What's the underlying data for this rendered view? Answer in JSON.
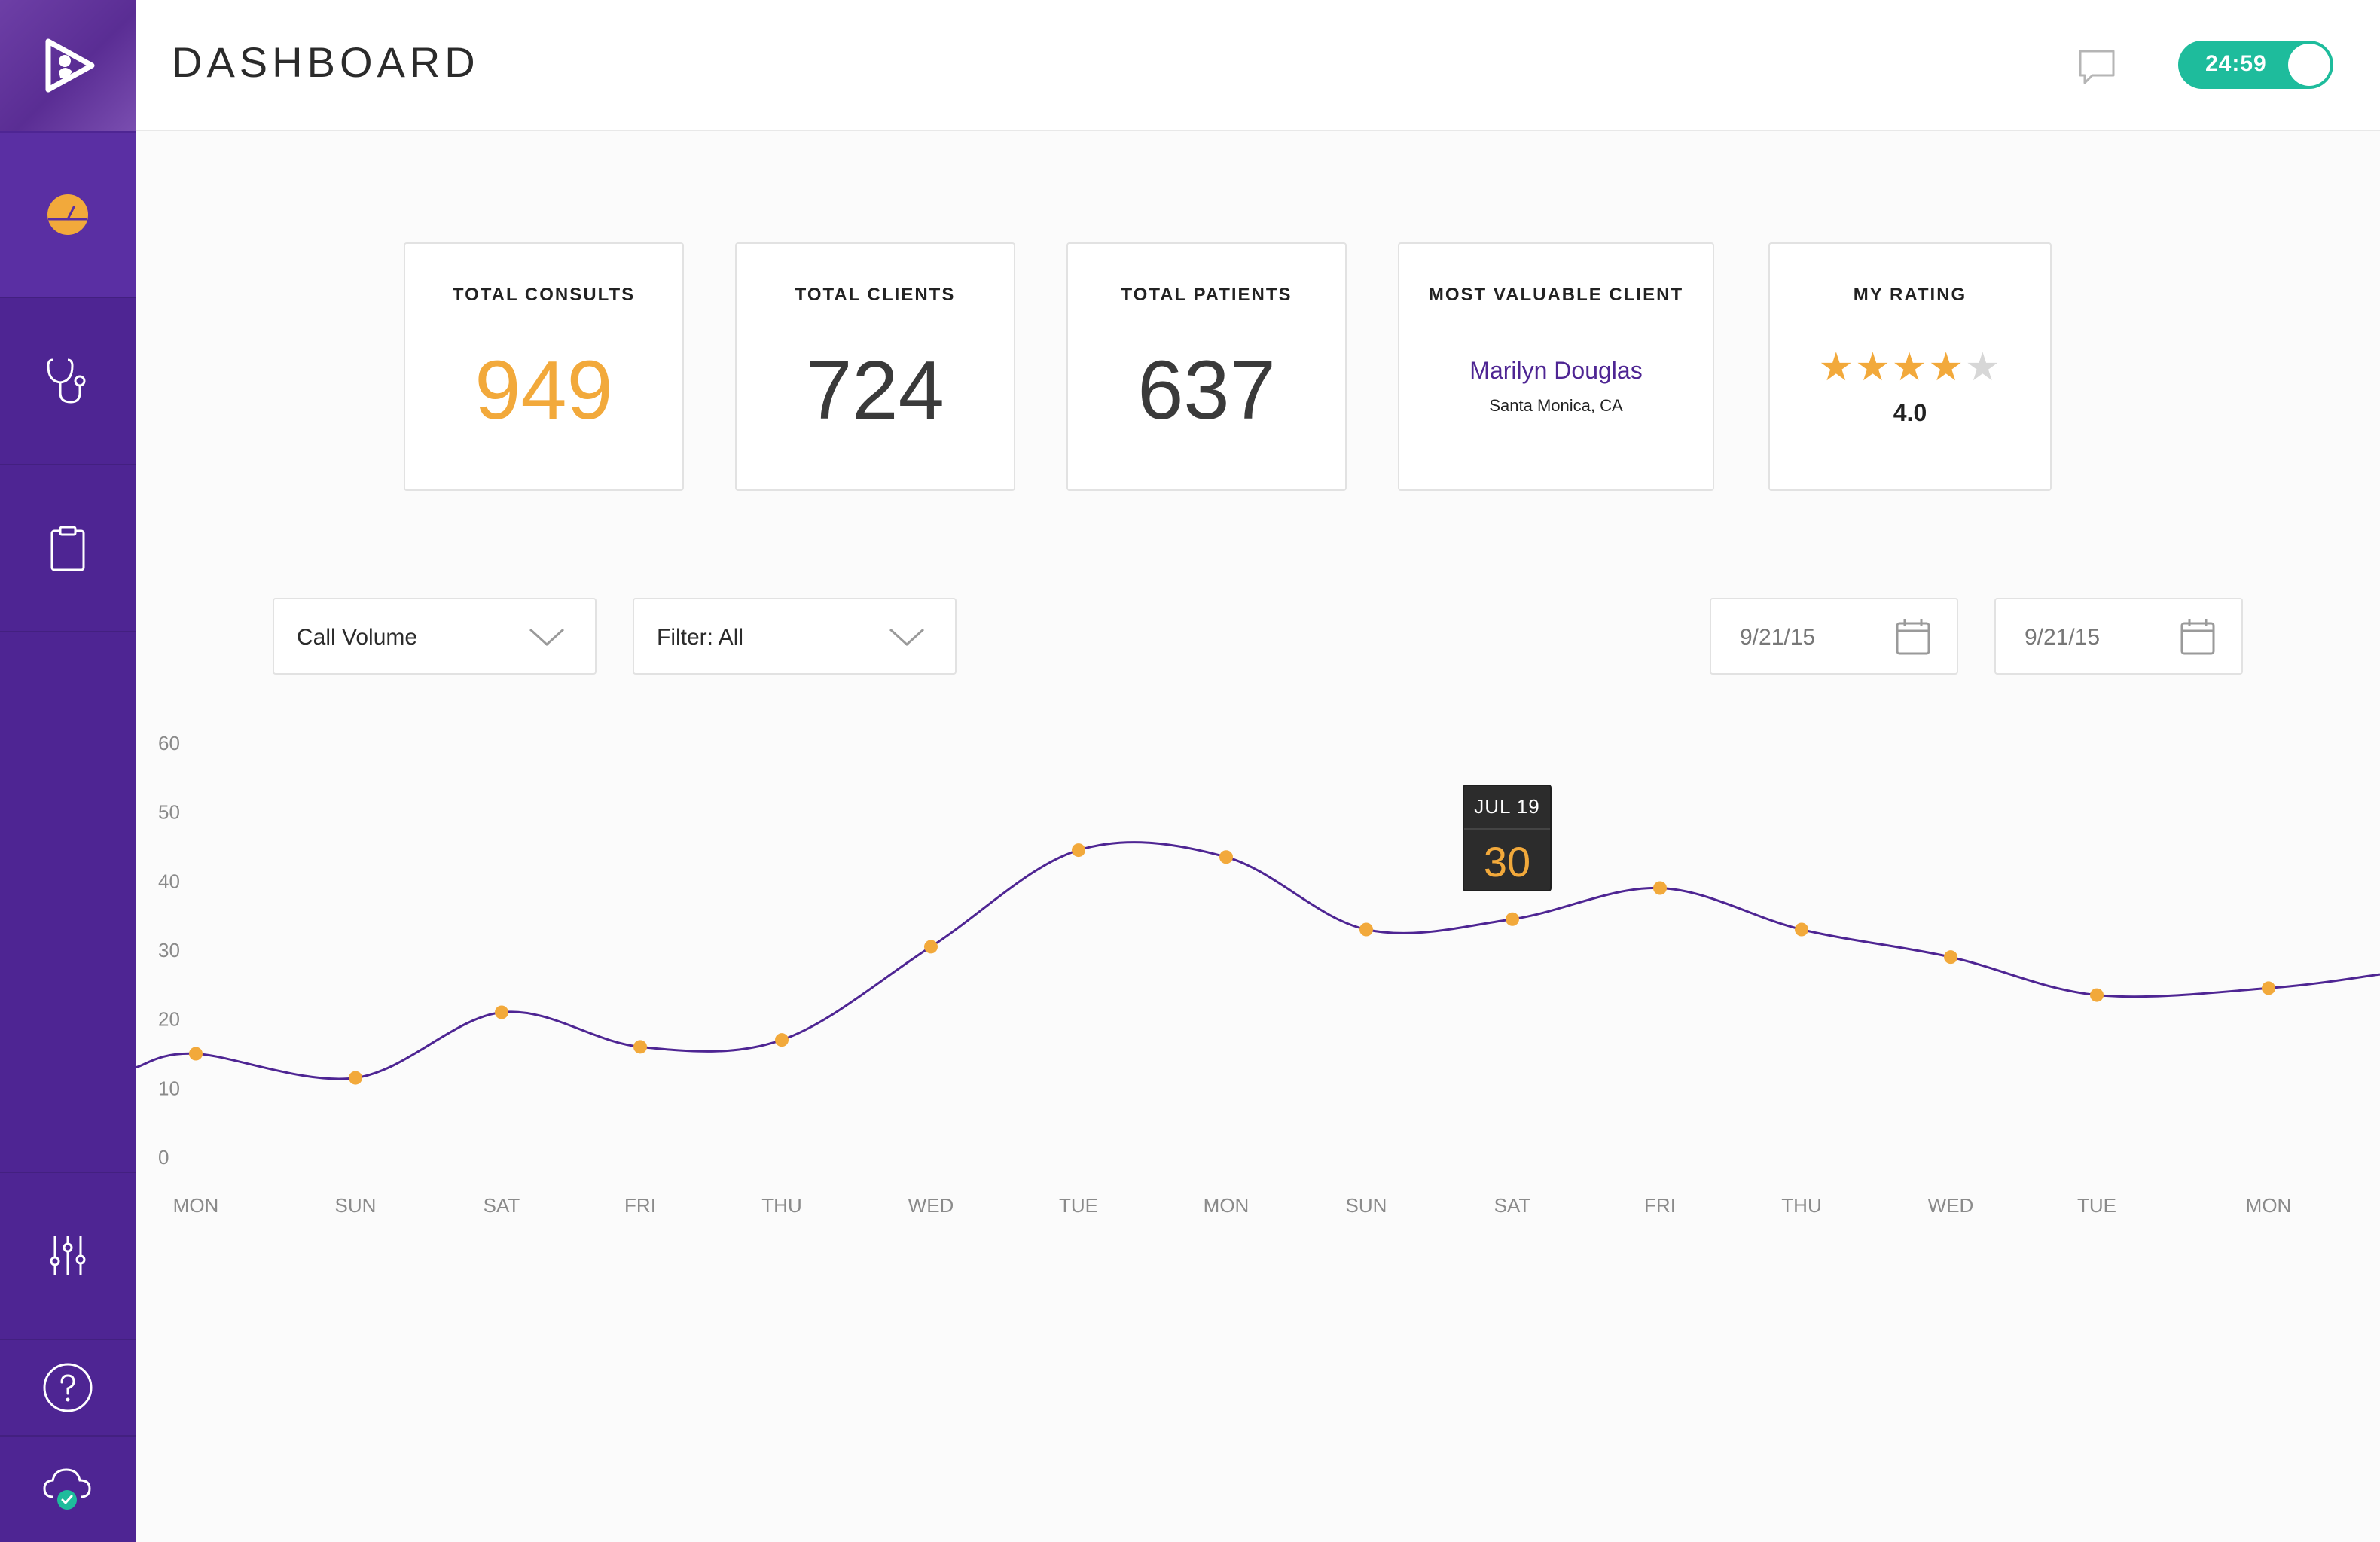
{
  "header": {
    "title": "DASHBOARD",
    "timer": "24:59"
  },
  "sidebar": {
    "items": [
      {
        "name": "dashboard",
        "icon": "speedometer-icon"
      },
      {
        "name": "consults",
        "icon": "stethoscope-icon"
      },
      {
        "name": "records",
        "icon": "clipboard-icon"
      },
      {
        "name": "settings",
        "icon": "sliders-icon"
      },
      {
        "name": "help",
        "icon": "help-icon"
      },
      {
        "name": "sync",
        "icon": "cloud-check-icon"
      }
    ]
  },
  "stats": {
    "consults": {
      "title": "TOTAL CONSULTS",
      "value": "949"
    },
    "clients": {
      "title": "TOTAL CLIENTS",
      "value": "724"
    },
    "patients": {
      "title": "TOTAL PATIENTS",
      "value": "637"
    },
    "valuable": {
      "title": "MOST VALUABLE CLIENT",
      "name": "Marilyn Douglas",
      "location": "Santa Monica, CA"
    },
    "rating": {
      "title": "MY RATING",
      "value": "4.0",
      "stars": 4,
      "max_stars": 5
    }
  },
  "controls": {
    "metric": "Call Volume",
    "filter": "Filter: All",
    "date_from": "9/21/15",
    "date_to": "9/21/15"
  },
  "tooltip": {
    "date": "JUL 19",
    "value": "30"
  },
  "colors": {
    "sidebar": "#4e2593",
    "accent_orange": "#f2a93b",
    "toggle_green": "#1ebc9c",
    "line": "#4e2593"
  },
  "chart_data": {
    "type": "line",
    "categories": [
      "MON",
      "SUN",
      "SAT",
      "FRI",
      "THU",
      "WED",
      "TUE",
      "MON",
      "SUN",
      "SAT",
      "FRI",
      "THU",
      "WED",
      "TUE",
      "MON"
    ],
    "values": [
      15,
      11.5,
      21,
      16,
      17,
      30.5,
      44.5,
      43.5,
      33,
      34.5,
      39,
      33,
      29,
      23.5,
      24.5
    ],
    "yticks": [
      0,
      10,
      20,
      30,
      40,
      50,
      60
    ],
    "ylim": [
      0,
      60
    ],
    "xlabel": "",
    "ylabel": ""
  }
}
